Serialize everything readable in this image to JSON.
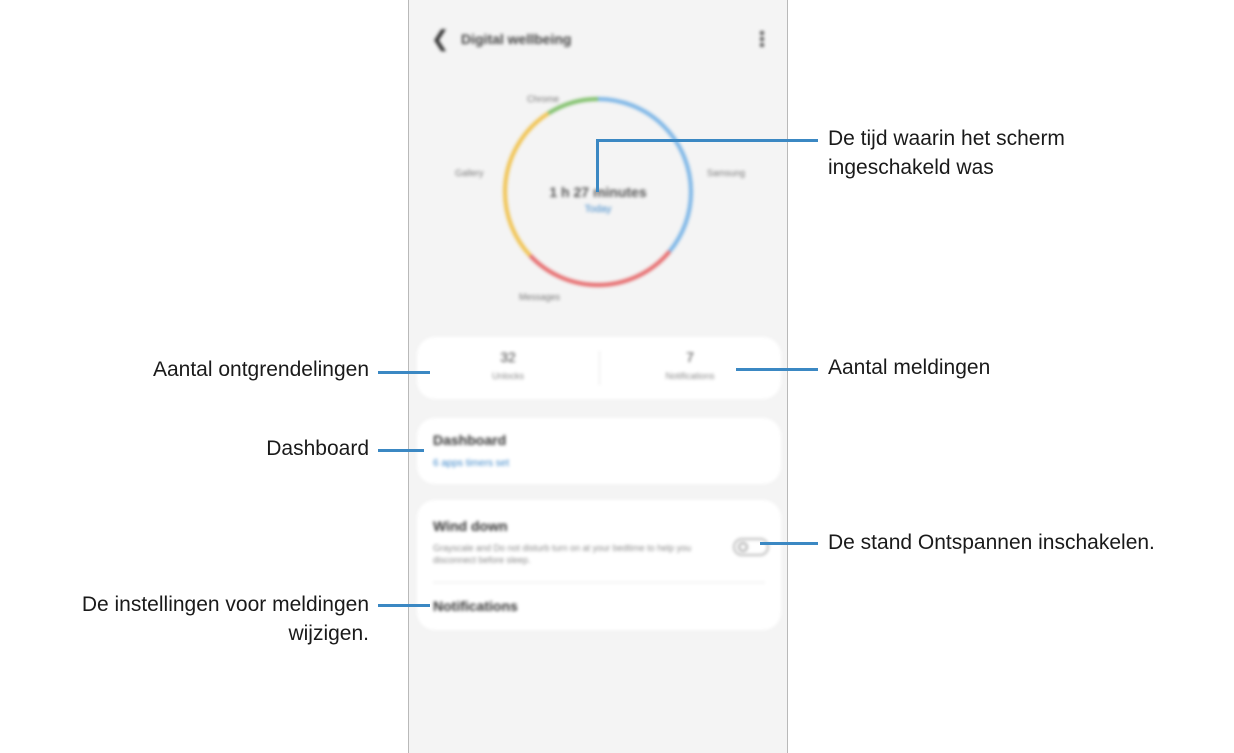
{
  "screen": {
    "app_title": "Digital wellbeing",
    "ring": {
      "center_value": "1 h 27 minutes",
      "center_link": "Today",
      "labels": {
        "top": "Chrome",
        "left": "Gallery",
        "right": "Samsung",
        "bottom": "Messages"
      },
      "segments": [
        {
          "color": "#79b4e6",
          "fraction": 0.36
        },
        {
          "color": "#e6686a",
          "fraction": 0.27
        },
        {
          "color": "#f0c24e",
          "fraction": 0.28
        },
        {
          "color": "#7dbf67",
          "fraction": 0.09
        }
      ]
    },
    "stats": {
      "unlocks_value": "32",
      "unlocks_label": "Unlocks",
      "notifications_value": "7",
      "notifications_label": "Notifications"
    },
    "dashboard": {
      "title": "Dashboard",
      "subtitle": "6 apps timers set"
    },
    "wind_down": {
      "title": "Wind down",
      "description": "Grayscale and Do not disturb turn on at your bedtime to help you disconnect before sleep.",
      "enabled": false
    },
    "notifications_item": "Notifications"
  },
  "callouts": {
    "screen_time_line1": "De tijd waarin het scherm",
    "screen_time_line2": "ingeschakeld was",
    "unlocks": "Aantal ontgrendelingen",
    "notifications_count": "Aantal meldingen",
    "dashboard": "Dashboard",
    "wind_down": "De stand Ontspannen inschakelen.",
    "notif_settings_line1": "De instellingen voor meldingen",
    "notif_settings_line2": "wijzigen."
  },
  "colors": {
    "callout_line": "#3b88c3",
    "accent_link": "#3d87c9"
  }
}
